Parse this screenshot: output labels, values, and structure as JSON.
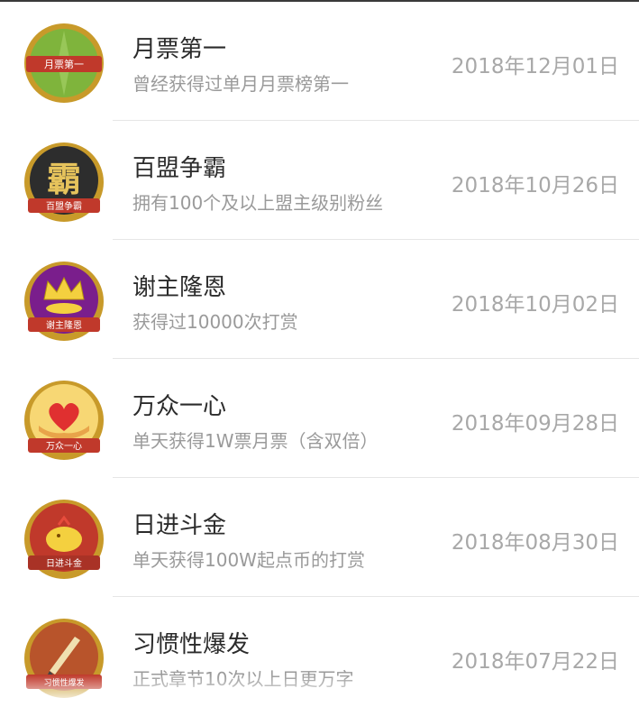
{
  "achievements": [
    {
      "title": "月票第一",
      "desc": "曾经获得过单月月票榜第一",
      "date": "2018年12月01日",
      "badge_label": "月票第一",
      "icon": "trophy-icon",
      "color": "#6aa84f"
    },
    {
      "title": "百盟争霸",
      "desc": "拥有100个及以上盟主级别粉丝",
      "date": "2018年10月26日",
      "badge_label": "百盟争霸",
      "badge_glyph": "霸",
      "icon": "ba-character-icon",
      "color": "#2d2d2d"
    },
    {
      "title": "谢主隆恩",
      "desc": "获得过10000次打赏",
      "date": "2018年10月02日",
      "badge_label": "谢主隆恩",
      "icon": "crown-icon",
      "color": "#7a1e8c"
    },
    {
      "title": "万众一心",
      "desc": "单天获得1W票月票（含双倍）",
      "date": "2018年09月28日",
      "badge_label": "万众一心",
      "icon": "heart-hands-icon",
      "color": "#f1c232"
    },
    {
      "title": "日进斗金",
      "desc": "单天获得100W起点币的打赏",
      "date": "2018年08月30日",
      "badge_label": "日进斗金",
      "icon": "money-pig-icon",
      "color": "#c0392b"
    },
    {
      "title": "习惯性爆发",
      "desc": "正式章节10次以上日更万字",
      "date": "2018年07月22日",
      "badge_label": "习惯性爆发",
      "icon": "pen-icon",
      "color": "#b8542b"
    }
  ]
}
